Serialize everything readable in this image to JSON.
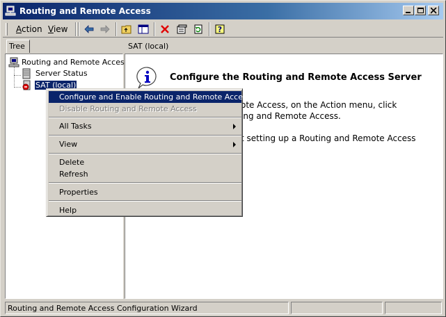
{
  "window": {
    "title": "Routing and Remote Access"
  },
  "menu": {
    "action": "Action",
    "view": "View"
  },
  "tree": {
    "tab_label": "Tree",
    "root": "Routing and Remote Access",
    "server_status": "Server Status",
    "server": "SAT (local)"
  },
  "right": {
    "header": "SAT (local)",
    "title": "Configure the Routing and Remote Access Server",
    "line1": "ote Access, on the Action menu, click",
    "line2": "ing and Remote Access.",
    "line3": "t setting up a Routing and Remote Access"
  },
  "context_menu": {
    "configure": "Configure and Enable Routing and Remote Access",
    "disable": "Disable Routing and Remote Access",
    "all_tasks": "All Tasks",
    "view": "View",
    "delete": "Delete",
    "refresh": "Refresh",
    "properties": "Properties",
    "help": "Help"
  },
  "statusbar": {
    "text": "Routing and Remote Access Configuration Wizard"
  },
  "colors": {
    "title_active": "#0a246a",
    "face": "#d4d0c8",
    "highlight": "#0a246a"
  }
}
